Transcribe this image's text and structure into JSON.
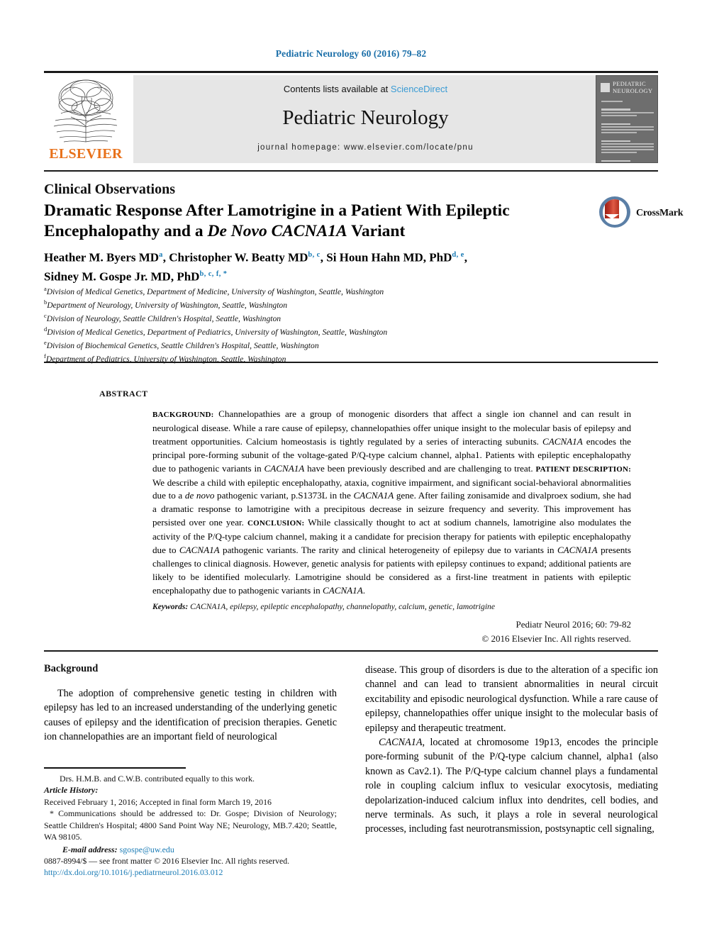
{
  "running_head": "Pediatric Neurology 60 (2016) 79–82",
  "journal_header": {
    "contents_prefix": "Contents lists available at ",
    "sciencedirect": "ScienceDirect",
    "journal_title": "Pediatric Neurology",
    "homepage": "journal homepage: www.elsevier.com/locate/pnu",
    "publisher": "ELSEVIER",
    "cover_title": "PEDIATRIC NEUROLOGY"
  },
  "article": {
    "section_label": "Clinical Observations",
    "title_line1": "Dramatic Response After Lamotrigine in a Patient With Epileptic",
    "title_line2_a": "Encephalopathy and a ",
    "title_line2_italic": "De Novo CACNA1A",
    "title_line2_b": " Variant",
    "crossmark_label": "CrossMark",
    "authors_line1": "Heather M. Byers MD",
    "authors_line1_sup1": "a",
    "authors_line1_b": ", Christopher W. Beatty MD",
    "authors_line1_sup2": "b, c",
    "authors_line1_c": ", Si Houn Hahn MD, PhD",
    "authors_line1_sup3": "d, e",
    "authors_line1_d": ",",
    "authors_line2": "Sidney M. Gospe Jr. MD, PhD",
    "authors_line2_sup": "b, c, f, *",
    "affiliations": [
      {
        "marker": "a",
        "text": "Division of Medical Genetics, Department of Medicine, University of Washington, Seattle, Washington"
      },
      {
        "marker": "b",
        "text": "Department of Neurology, University of Washington, Seattle, Washington"
      },
      {
        "marker": "c",
        "text": "Division of Neurology, Seattle Children's Hospital, Seattle, Washington"
      },
      {
        "marker": "d",
        "text": "Division of Medical Genetics, Department of Pediatrics, University of Washington, Seattle, Washington"
      },
      {
        "marker": "e",
        "text": "Division of Biochemical Genetics, Seattle Children's Hospital, Seattle, Washington"
      },
      {
        "marker": "f",
        "text": "Department of Pediatrics, University of Washington, Seattle, Washington"
      }
    ]
  },
  "abstract": {
    "label": "ABSTRACT",
    "head_background": "BACKGROUND:",
    "background_text": " Channelopathies are a group of monogenic disorders that affect a single ion channel and can result in neurological disease. While a rare cause of epilepsy, channelopathies offer unique insight to the molecular basis of epilepsy and treatment opportunities. Calcium homeostasis is tightly regulated by a series of interacting subunits. ",
    "gene1": "CACNA1A",
    "background_text2": " encodes the principal pore-forming subunit of the voltage-gated P/Q-type calcium channel, alpha1. Patients with epileptic encephalopathy due to pathogenic variants in ",
    "gene2": "CACNA1A",
    "background_text3": " have been previously described and are challenging to treat. ",
    "head_patient": "PATIENT DESCRIPTION:",
    "patient_text": " We describe a child with epileptic encephalopathy, ataxia, cognitive impairment, and significant social-behavioral abnormalities due to a ",
    "denovo": "de novo",
    "patient_text2": " pathogenic variant, p.S1373L in the ",
    "gene3": "CACNA1A",
    "patient_text3": " gene. After failing zonisamide and divalproex sodium, she had a dramatic response to lamotrigine with a precipitous decrease in seizure frequency and severity. This improvement has persisted over one year. ",
    "head_conclusion": "CONCLUSION:",
    "conclusion_text": " While classically thought to act at sodium channels, lamotrigine also modulates the activity of the P/Q-type calcium channel, making it a candidate for precision therapy for patients with epileptic encephalopathy due to ",
    "gene4": "CACNA1A",
    "conclusion_text2": " pathogenic variants. The rarity and clinical heterogeneity of epilepsy due to variants in ",
    "gene5": "CACNA1A",
    "conclusion_text3": " presents challenges to clinical diagnosis. However, genetic analysis for patients with epilepsy continues to expand; additional patients are likely to be identified molecularly. Lamotrigine should be considered as a first-line treatment in patients with epileptic encephalopathy due to pathogenic variants in ",
    "gene6": "CACNA1A",
    "conclusion_text4": ".",
    "keywords_label": "Keywords:",
    "keywords_value": " CACNA1A, epilepsy, epileptic encephalopathy, channelopathy, calcium, genetic, lamotrigine",
    "citation": "Pediatr Neurol 2016; 60: 79-82",
    "copyright": "© 2016 Elsevier Inc. All rights reserved."
  },
  "body": {
    "left_heading": "Background",
    "left_par1": "The adoption of comprehensive genetic testing in children with epilepsy has led to an increased understanding of the underlying genetic causes of epilepsy and the identification of precision therapies. Genetic ion channelopathies are an important field of neurological",
    "right_par1": "disease. This group of disorders is due to the alteration of a specific ion channel and can lead to transient abnormalities in neural circuit excitability and episodic neurological dysfunction. While a rare cause of epilepsy, channelopathies offer unique insight to the molecular basis of epilepsy and therapeutic treatment.",
    "right_par2_gene": "CACNA1A",
    "right_par2": ", located at chromosome 19p13, encodes the principle pore-forming subunit of the P/Q-type calcium channel, alpha1 (also known as Cav2.1). The P/Q-type calcium channel plays a fundamental role in coupling calcium influx to vesicular exocytosis, mediating depolarization-induced calcium influx into dendrites, cell bodies, and nerve terminals. As such, it plays a role in several neurological processes, including fast neurotransmission, postsynaptic cell signaling,"
  },
  "footnotes": {
    "equal_contribution": "Drs. H.M.B. and C.W.B. contributed equally to this work.",
    "article_history_label": "Article History:",
    "article_history": "Received February 1, 2016; Accepted in final form March 19, 2016",
    "correspondence": "* Communications should be addressed to: Dr. Gospe; Division of Neurology; Seattle Children's Hospital; 4800 Sand Point Way NE; Neurology, MB.7.420; Seattle, WA 98105.",
    "email_label": "E-mail address:",
    "email_value": " sgospe@uw.edu"
  },
  "issn": {
    "line1": "0887-8994/$ — see front matter © 2016 Elsevier Inc. All rights reserved.",
    "doi": "http://dx.doi.org/10.1016/j.pediatrneurol.2016.03.012"
  },
  "colors": {
    "link_blue": "#1a7bb5",
    "sciencedirect_blue": "#3a9bd4",
    "elsevier_orange": "#e8711a",
    "header_band": "#e6e6e6"
  }
}
